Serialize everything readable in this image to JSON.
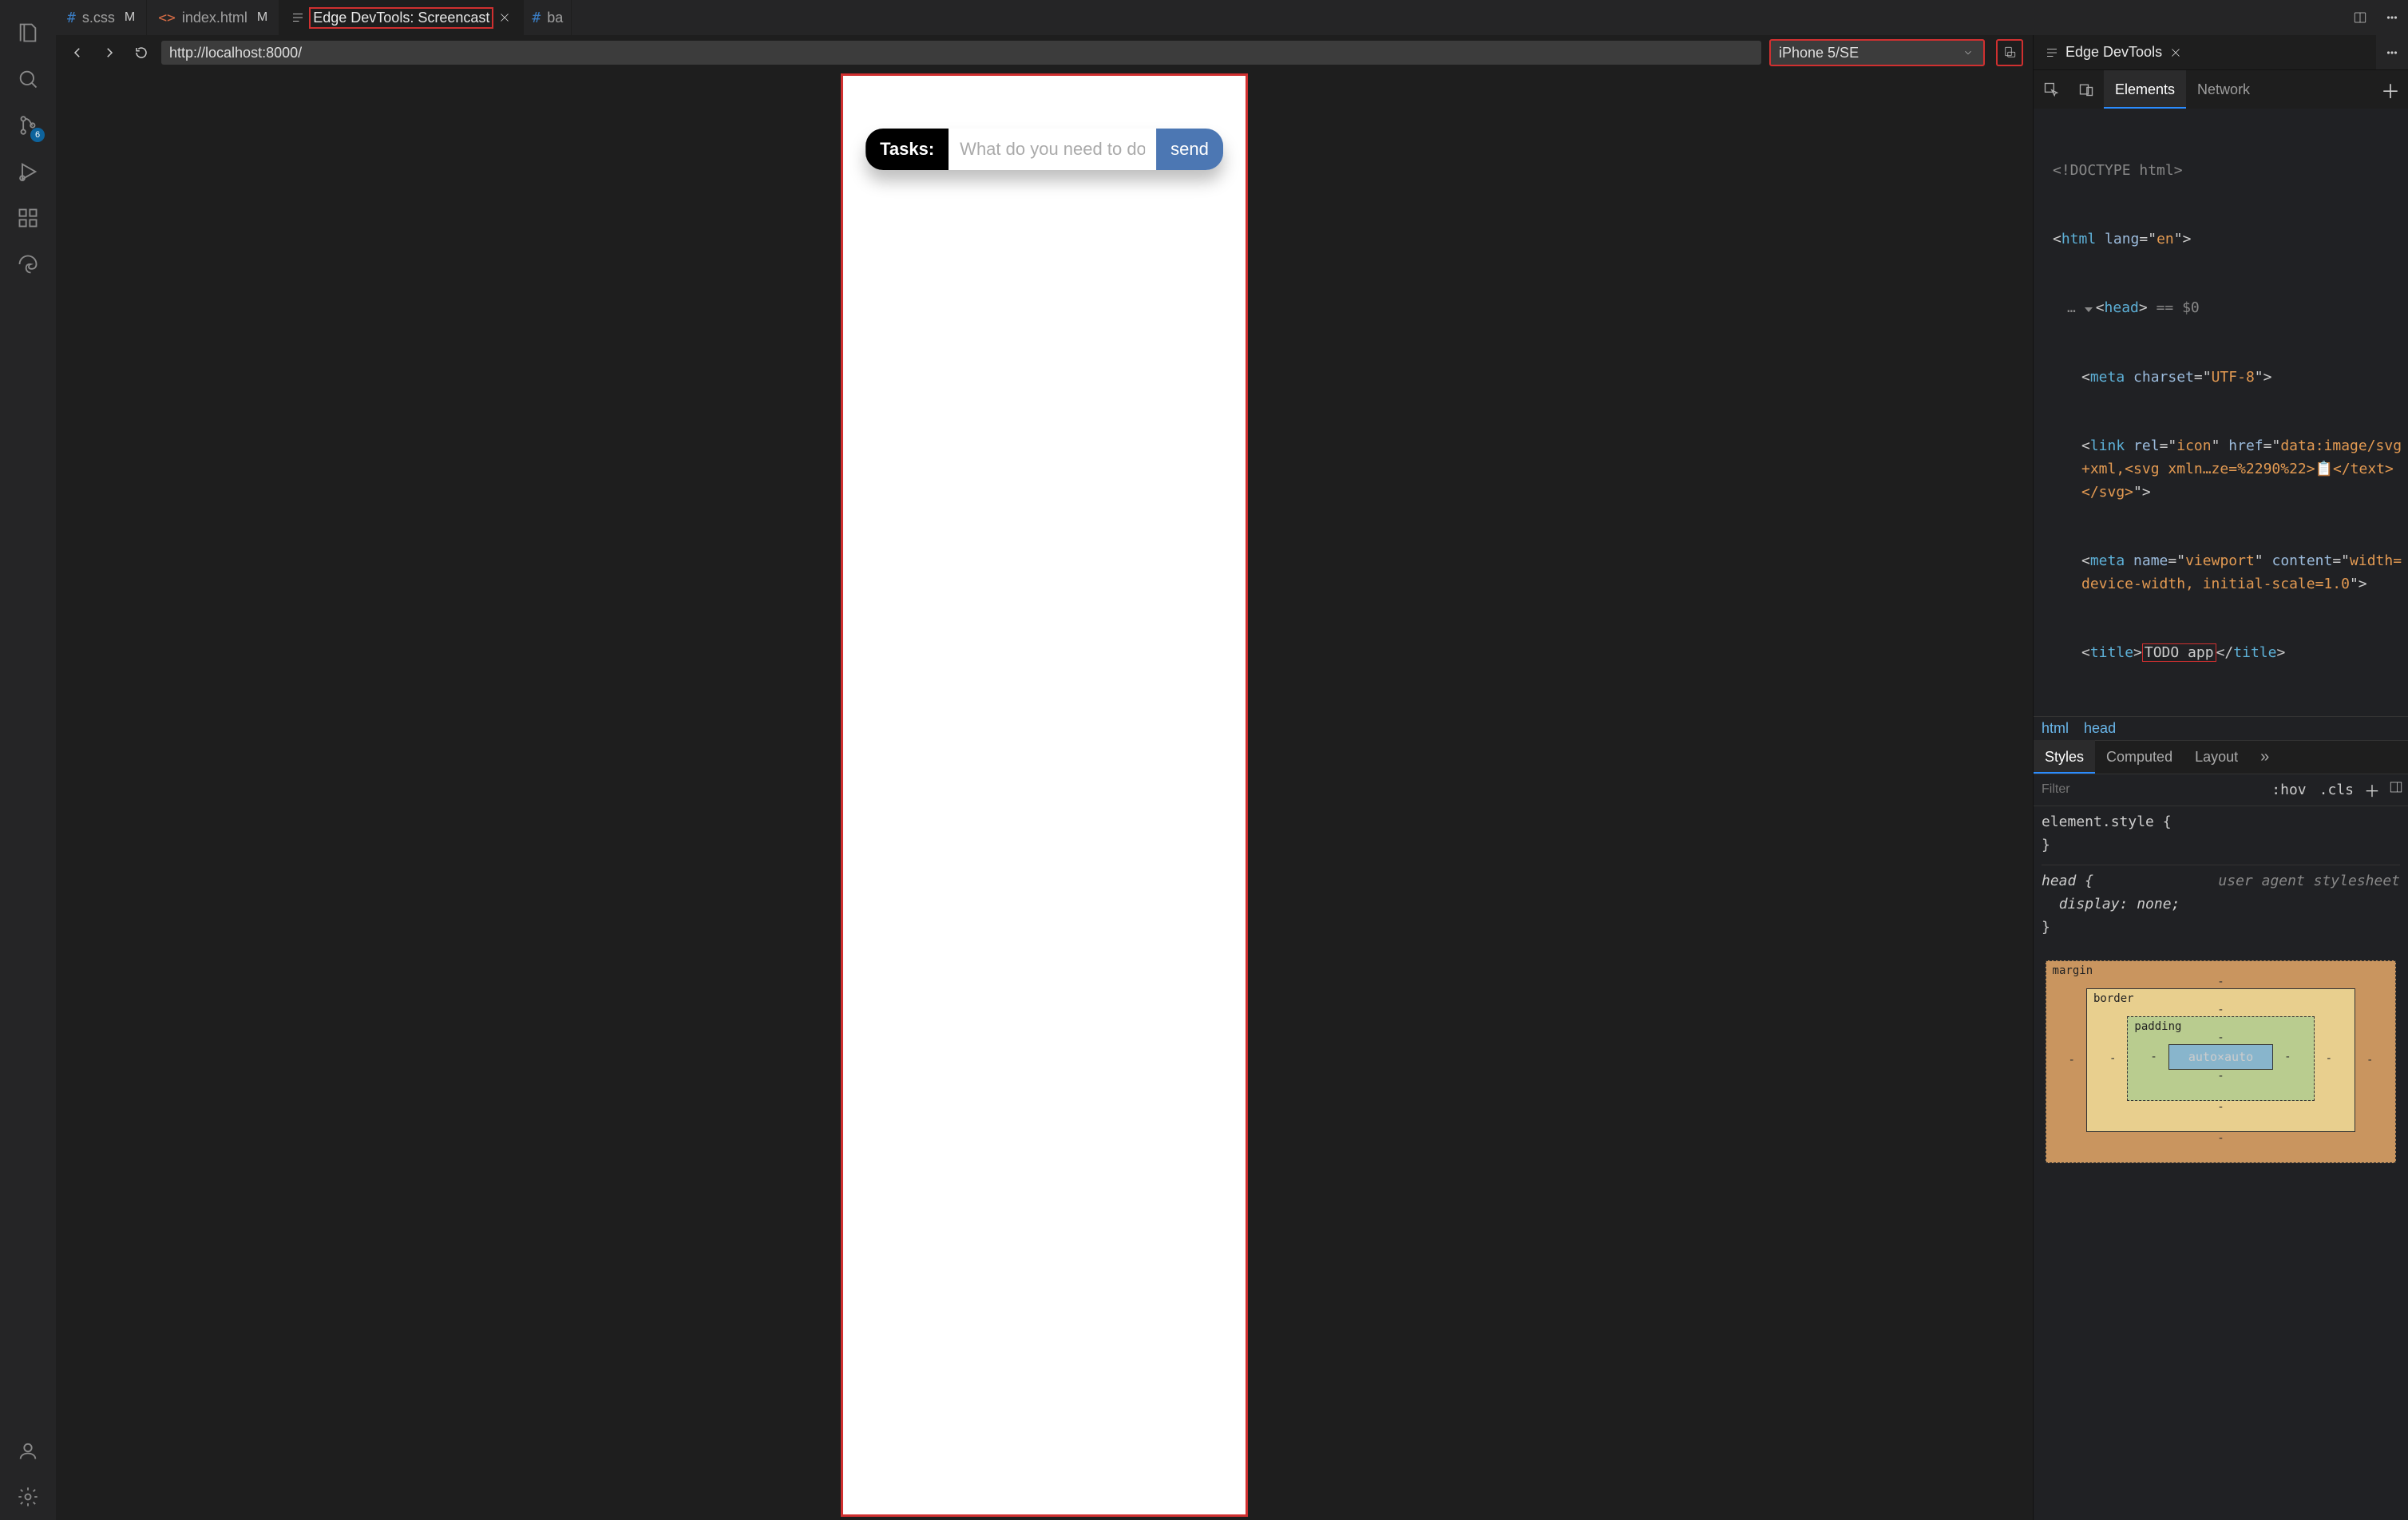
{
  "activity": {
    "source_control_badge": "6"
  },
  "editor_tabs": {
    "css": {
      "label": "s.css",
      "modified": "M",
      "icon_color": "#3a7cc2"
    },
    "html": {
      "label": "index.html",
      "modified": "M",
      "icon_color": "#d26a44"
    },
    "screencast": {
      "label": "Edge DevTools: Screencast"
    },
    "base": {
      "label": "ba",
      "icon": "#"
    },
    "devtools": {
      "label": "Edge DevTools"
    }
  },
  "screencast": {
    "url": "http://localhost:8000/",
    "device": "iPhone 5/SE",
    "page": {
      "task_label": "Tasks:",
      "task_placeholder": "What do you need to do",
      "task_send": "send"
    }
  },
  "devtools": {
    "main_tabs": {
      "elements": "Elements",
      "network": "Network"
    },
    "dom": {
      "doctype": "<!DOCTYPE html>",
      "html_open": "html",
      "html_lang": "en",
      "head": "head",
      "dollar0": "== $0",
      "meta_charset_attr": "charset",
      "meta_charset_val": "UTF-8",
      "link_rel": "icon",
      "link_href": "data:image/svg+xml,<svg xmln…ze=%2290%22>📋</text></svg>",
      "meta_name": "viewport",
      "meta_content": "width=device-width, initial-scale=1.0",
      "title_tag": "title",
      "title_text": "TODO app"
    },
    "crumbs": {
      "html": "html",
      "head": "head"
    },
    "styles_tabs": {
      "styles": "Styles",
      "computed": "Computed",
      "layout": "Layout"
    },
    "styles_bar": {
      "filter": "Filter",
      "hov": ":hov",
      "cls": ".cls"
    },
    "rules": {
      "element_style": "element.style {",
      "brace_close": "}",
      "head_sel": "head {",
      "head_decl": "display: none;",
      "ua": "user agent stylesheet"
    },
    "boxmodel": {
      "margin": "margin",
      "border": "border",
      "padding": "padding",
      "content": "auto×auto",
      "dash": "-"
    }
  }
}
